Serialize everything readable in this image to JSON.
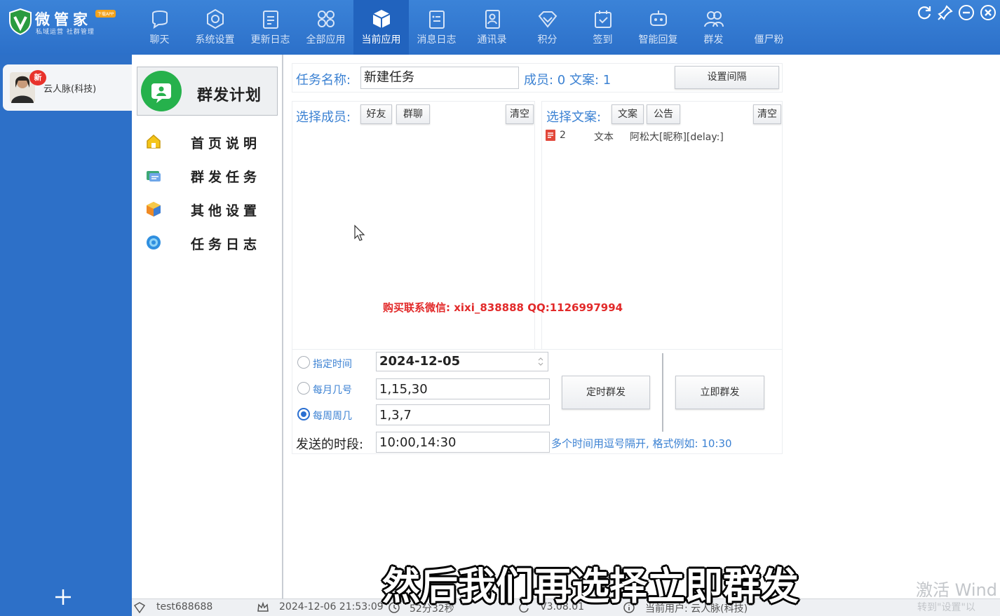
{
  "app": {
    "name": "微管家",
    "tagline": "私域运营 社群管理",
    "badge": "下载APP"
  },
  "nav": [
    {
      "label": "聊天",
      "icon": "chat-icon"
    },
    {
      "label": "系统设置",
      "icon": "gear-icon"
    },
    {
      "label": "更新日志",
      "icon": "clipboard-icon"
    },
    {
      "label": "全部应用",
      "icon": "apps-grid-icon"
    },
    {
      "label": "当前应用",
      "icon": "cube-icon",
      "active": true
    },
    {
      "label": "消息日志",
      "icon": "message-log-icon"
    },
    {
      "label": "通讯录",
      "icon": "contacts-icon"
    },
    {
      "label": "积分",
      "icon": "diamond-icon"
    },
    {
      "label": "签到",
      "icon": "checkin-icon"
    },
    {
      "label": "智能回复",
      "icon": "smart-reply-icon"
    },
    {
      "label": "群发",
      "icon": "group-send-icon"
    },
    {
      "label": "僵尸粉",
      "icon": "zombie-fans-icon"
    }
  ],
  "account": {
    "name": "云人脉(科技)",
    "badge": "新"
  },
  "menu": {
    "header": "群发计划",
    "items": [
      {
        "label": "首页说明",
        "icon": "home-icon"
      },
      {
        "label": "群发任务",
        "icon": "task-icon"
      },
      {
        "label": "其他设置",
        "icon": "settings-box-icon"
      },
      {
        "label": "任务日志",
        "icon": "log-gear-icon"
      }
    ]
  },
  "task": {
    "name_label": "任务名称:",
    "name_value": "新建任务",
    "members_summary": "成员: 0 文案: 1",
    "set_interval": "设置间隔"
  },
  "members": {
    "label": "选择成员:",
    "friend_btn": "好友",
    "group_btn": "群聊",
    "clear_btn": "清空"
  },
  "copy": {
    "label": "选择文案:",
    "text_btn": "文案",
    "notice_btn": "公告",
    "clear_btn": "清空",
    "rows": [
      {
        "id": "2",
        "type": "文本",
        "content": "阿松大[昵称][delay:]"
      }
    ]
  },
  "schedule": {
    "specified_time": {
      "label": "指定时间",
      "value": "2024-12-05",
      "checked": false
    },
    "monthly": {
      "label": "每月几号",
      "value": "1,15,30",
      "checked": false
    },
    "weekly": {
      "label": "每周周几",
      "value": "1,3,7",
      "checked": true
    },
    "period_label": "发送的时段:",
    "period_value": "10:00,14:30",
    "hint": "多个时间用逗号隔开, 格式例如: 10:30",
    "timed_btn": "定时群发",
    "instant_btn": "立即群发"
  },
  "overlay": {
    "watermark": "购买联系微信: xixi_838888    QQ:1126997994",
    "subtitle": "然后我们再选择立即群发",
    "activate_title": "激活 Wind",
    "activate_sub": "转到\"设置\"以"
  },
  "status": {
    "user": "test688688",
    "datetime": "2024-12-06 21:53:09",
    "uptime": "52分32秒",
    "version": "V3.08.01",
    "current_user": "当前用户: 云人脉(科技)"
  },
  "colors": {
    "topbar": "#3b83d8",
    "accent": "#3c82d3",
    "plan_green": "#26b14c"
  }
}
